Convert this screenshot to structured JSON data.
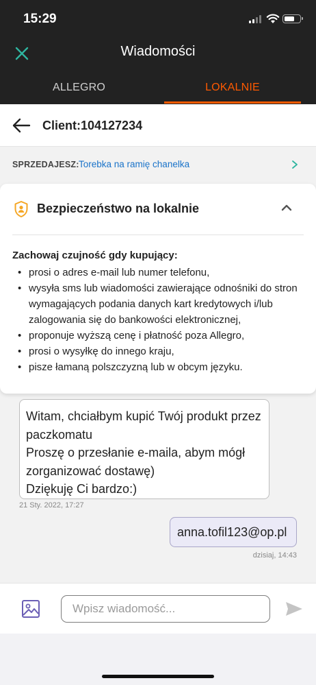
{
  "status_bar": {
    "time": "15:29"
  },
  "header": {
    "title": "Wiadomości"
  },
  "tabs": [
    {
      "label": "ALLEGRO",
      "active": false
    },
    {
      "label": "LOKALNIE",
      "active": true
    }
  ],
  "conversation": {
    "client_name": "Client:104127234"
  },
  "seller": {
    "label": "SPRZEDAJESZ:",
    "item_title": "Torebka na ramię chanelka"
  },
  "security_notice": {
    "title": "Bezpieczeństwo na lokalnie",
    "heading": "Zachowaj czujność gdy kupujący:",
    "items": [
      "prosi o adres e-mail lub numer telefonu,",
      "wysyła sms lub wiadomości zawierające odnośniki do stron wymagających podania danych kart kredytowych i/lub zalogowania się do bankowości elektronicznej,",
      "proponuje wyższą cenę i płatność poza Allegro,",
      "prosi o wysyłkę do innego kraju,",
      "pisze łamaną polszczyzną lub w obcym języku."
    ]
  },
  "messages": [
    {
      "direction": "incoming",
      "text": "Witam, chciałbym kupić Twój produkt przez paczkomatu\nProszę o przesłanie e-maila, abym mógł zorganizować dostawę)\nDziękuję Ci bardzo:)",
      "timestamp": "21 Sty. 2022, 17:27"
    },
    {
      "direction": "outgoing",
      "text": "anna.tofil123@op.pl",
      "timestamp": "dzisiaj, 14:43"
    }
  ],
  "composer": {
    "placeholder": "Wpisz wiadomość..."
  },
  "colors": {
    "accent": "#ff5a00",
    "link": "#1a73c9",
    "header_bg": "#222222",
    "close_icon": "#2fb5a0",
    "shield_icon": "#f5a623",
    "image_icon": "#6b5fb5",
    "outgoing_bubble": "#ebeaf7"
  },
  "icons": {
    "close": "close-icon",
    "back": "arrow-left-icon",
    "seller_chevron": "chevron-right-icon",
    "security": "shield-user-icon",
    "collapse": "chevron-up-icon",
    "attach_image": "image-icon",
    "send": "send-icon"
  }
}
